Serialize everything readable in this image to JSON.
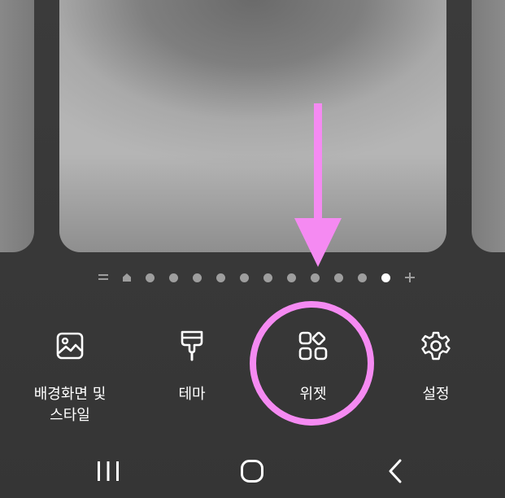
{
  "indicator": {
    "count": 14,
    "menu_symbol": "=",
    "home_symbol": "home-icon",
    "add_symbol": "+",
    "active_index": 12
  },
  "menu": {
    "items": [
      {
        "label": "배경화면 및\n스타일",
        "icon": "image-icon"
      },
      {
        "label": "테마",
        "icon": "paint-brush-icon"
      },
      {
        "label": "위젯",
        "icon": "widgets-icon"
      },
      {
        "label": "설정",
        "icon": "gear-icon"
      }
    ]
  },
  "annotations": {
    "arrow_color": "#f58af2",
    "ring_color": "#f58af2"
  },
  "navbar": {
    "recent": "recent-apps-icon",
    "home": "home-button-icon",
    "back": "back-icon"
  }
}
